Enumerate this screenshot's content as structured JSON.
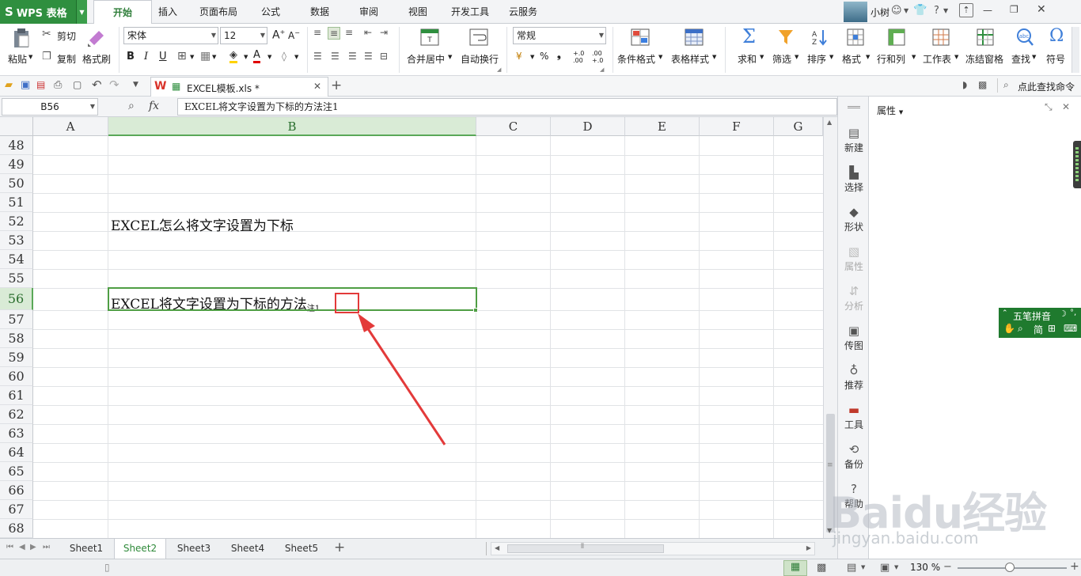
{
  "app": {
    "name": "WPS 表格",
    "user_name": "小树",
    "help_label": "?"
  },
  "ribbon_tabs": [
    "开始",
    "插入",
    "页面布局",
    "公式",
    "数据",
    "审阅",
    "视图",
    "开发工具",
    "云服务"
  ],
  "ribbon": {
    "paste": "粘贴",
    "cut": "剪切",
    "copy": "复制",
    "format_painter": "格式刷",
    "font_name": "宋体",
    "font_size": "12",
    "bold": "B",
    "italic": "I",
    "underline": "U",
    "font_color_letter": "A",
    "merge_center": "合并居中",
    "wrap_text": "自动换行",
    "number_format": "常规",
    "percent": "%",
    "comma": "❟",
    "inc_decimal": "+.0 .00",
    "dec_decimal": ".00 +.0",
    "conditional_format": "条件格式",
    "table_style": "表格样式",
    "sum": "求和",
    "filter": "筛选",
    "sort": "排序",
    "format": "格式",
    "row_col": "行和列",
    "worksheet": "工作表",
    "freeze": "冻结窗格",
    "find": "查找",
    "symbol": "符号"
  },
  "doc_tab": {
    "title": "EXCEL模板.xls *",
    "search_command": "点此查找命令"
  },
  "formula_bar": {
    "name_box": "B56",
    "fx": "fx",
    "content": "EXCEL将文字设置为下标的方法注1"
  },
  "columns": [
    "A",
    "B",
    "C",
    "D",
    "E",
    "F",
    "G"
  ],
  "selected_column": "B",
  "rows": [
    "48",
    "49",
    "50",
    "51",
    "52",
    "53",
    "54",
    "55",
    "56",
    "57",
    "58",
    "59",
    "60",
    "61",
    "62",
    "63",
    "64",
    "65",
    "66",
    "67",
    "68"
  ],
  "selected_row": "56",
  "cells": {
    "B52": "EXCEL怎么将文字设置为下标",
    "B56_main": "EXCEL将文字设置为下标的方法",
    "B56_sub": "注1"
  },
  "sheets": [
    "Sheet1",
    "Sheet2",
    "Sheet3",
    "Sheet4",
    "Sheet5"
  ],
  "active_sheet": "Sheet2",
  "status": {
    "zoom": "130 %",
    "zoom_fraction": 0.48
  },
  "task_pane": {
    "title": "属性",
    "items": [
      {
        "label": "新建",
        "icon": "new-icon",
        "enabled": true
      },
      {
        "label": "选择",
        "icon": "select-icon",
        "enabled": true
      },
      {
        "label": "形状",
        "icon": "shape-icon",
        "enabled": true
      },
      {
        "label": "属性",
        "icon": "property-icon",
        "enabled": false
      },
      {
        "label": "分析",
        "icon": "analyze-icon",
        "enabled": false
      },
      {
        "label": "传图",
        "icon": "upload-image-icon",
        "enabled": true
      },
      {
        "label": "推荐",
        "icon": "recommend-icon",
        "enabled": true
      },
      {
        "label": "工具",
        "icon": "toolbox-icon",
        "enabled": true
      },
      {
        "label": "备份",
        "icon": "backup-icon",
        "enabled": true
      },
      {
        "label": "帮助",
        "icon": "help-icon",
        "enabled": true
      }
    ]
  },
  "ime": {
    "mode": "五笔拼音",
    "simp": "简"
  },
  "watermark": {
    "brand": "Baidu经验",
    "url": "jingyan.baidu.com"
  },
  "colors": {
    "accent_green": "#2f8f3f",
    "selection_green": "#4f9e44",
    "annotation_red": "#e33a3a"
  }
}
